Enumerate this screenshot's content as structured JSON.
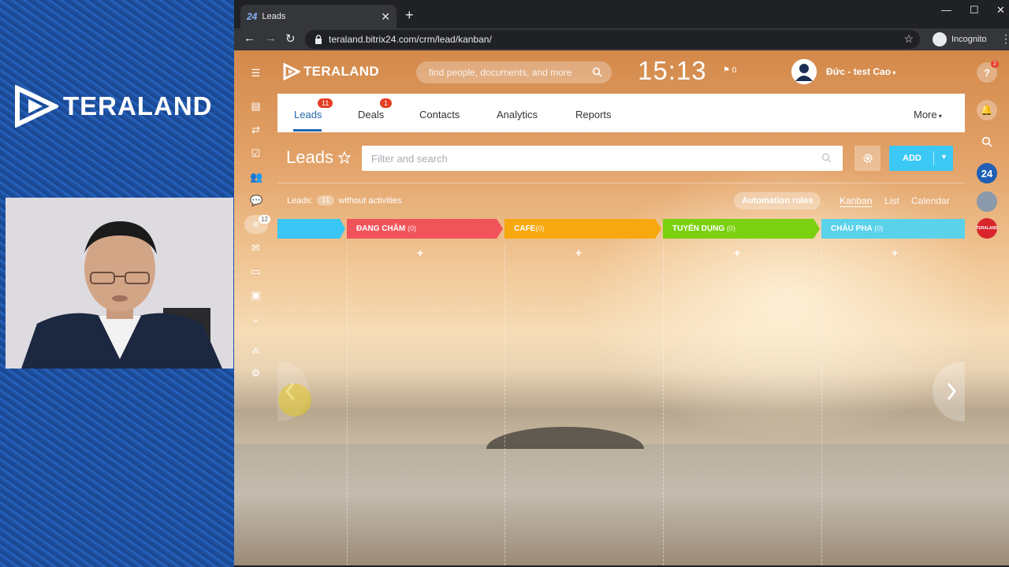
{
  "left_panel": {
    "logo_text": "TERALAND"
  },
  "browser": {
    "tab_favicon": "24",
    "tab_title": "Leads",
    "url": "teraland.bitrix24.com/crm/lead/kanban/",
    "profile_label": "Incognito"
  },
  "header": {
    "brand": "TERALAND",
    "search_placeholder": "find people, documents, and more",
    "clock": "15:13",
    "flag_count": "0",
    "user_name": "Đức - test Cao"
  },
  "sidebar": {
    "badge": "12"
  },
  "right_sidebar": {
    "help_badge": "2",
    "b24_label": "24",
    "teraland_label": "TERALAND"
  },
  "tabs": [
    {
      "label": "Leads",
      "badge": "11"
    },
    {
      "label": "Deals",
      "badge": "1"
    },
    {
      "label": "Contacts"
    },
    {
      "label": "Analytics"
    },
    {
      "label": "Reports"
    },
    {
      "label": "More"
    }
  ],
  "toolbar": {
    "title": "Leads",
    "filter_placeholder": "Filter and search",
    "add_label": "ADD"
  },
  "counters": {
    "prefix": "Leads:",
    "count": "11",
    "suffix": "without activities",
    "automation": "Automation rules"
  },
  "views": [
    "Kanban",
    "List",
    "Calendar"
  ],
  "stages": [
    {
      "name": "",
      "count": "",
      "color": "#39c6f4"
    },
    {
      "name": "ĐANG CHĂM",
      "count": "(0)",
      "color": "#f0545a"
    },
    {
      "name": "CAFE",
      "count": "(0)",
      "color": "#f7a80f"
    },
    {
      "name": "TUYỂN DỤNG",
      "count": "(0)",
      "color": "#7bd10f"
    },
    {
      "name": "CHÂU PHA",
      "count": "(0)",
      "color": "#5ad2ea"
    }
  ],
  "stage_add_symbol": "+",
  "colors": {
    "accent": "#2067b0",
    "add_button": "#3bc8f5",
    "badge": "#e43d22"
  },
  "icons": [
    "menu-icon",
    "feed-icon",
    "tasks-icon",
    "check-icon",
    "users-icon",
    "chat-icon",
    "crm-filter-icon",
    "mail-icon",
    "drive-icon",
    "contact-card-icon",
    "chevron-down-circle-icon",
    "sitemap-icon",
    "gear-icon"
  ]
}
